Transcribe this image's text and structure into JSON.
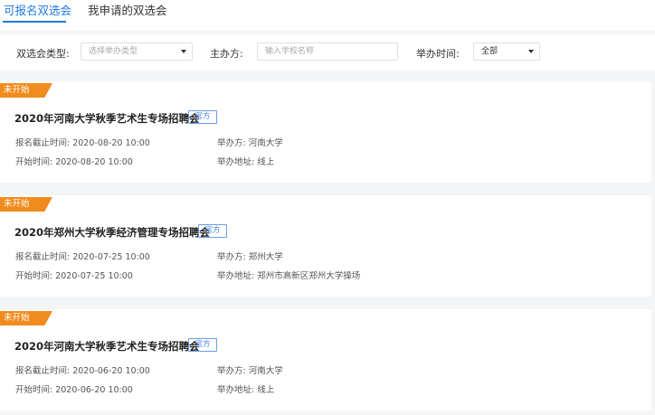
{
  "tabs": {
    "active": "可报名双选会",
    "inactive": "我申请的双选会"
  },
  "filters": {
    "type_label": "双选会类型:",
    "type_placeholder": "选择举办类型",
    "host_label": "主办方:",
    "host_placeholder": "输入学校名称",
    "time_label": "举办时间:",
    "time_value": "全部"
  },
  "cards": [
    {
      "status": "未开始",
      "title": "2020年河南大学秋季艺术生专场招聘会",
      "badge": "官方",
      "deadline": "报名截止时间: 2020-08-20  10:00",
      "start": "开始时间: 2020-08-20  10:00",
      "host": "举办方: 河南大学",
      "address": "举办地址: 线上"
    },
    {
      "status": "未开始",
      "title": "2020年郑州大学秋季经济管理专场招聘会",
      "badge": "官方",
      "deadline": "报名截止时间: 2020-07-25  10:00",
      "start": "开始时间: 2020-07-25  10:00",
      "host": "举办方: 郑州大学",
      "address": "举办地址: 郑州市高新区郑州大学操场"
    },
    {
      "status": "未开始",
      "title": "2020年河南大学秋季艺术生专场招聘会",
      "badge": "官方",
      "deadline": "报名截止时间: 2020-06-20  10:00",
      "start": "开始时间: 2020-06-20  10:00",
      "host": "举办方: 河南大学",
      "address": "举办地址: 线上"
    }
  ],
  "colors": {
    "accent": "#1f7ae0",
    "status": "#f08c1e",
    "badge": "#4a86e0"
  }
}
